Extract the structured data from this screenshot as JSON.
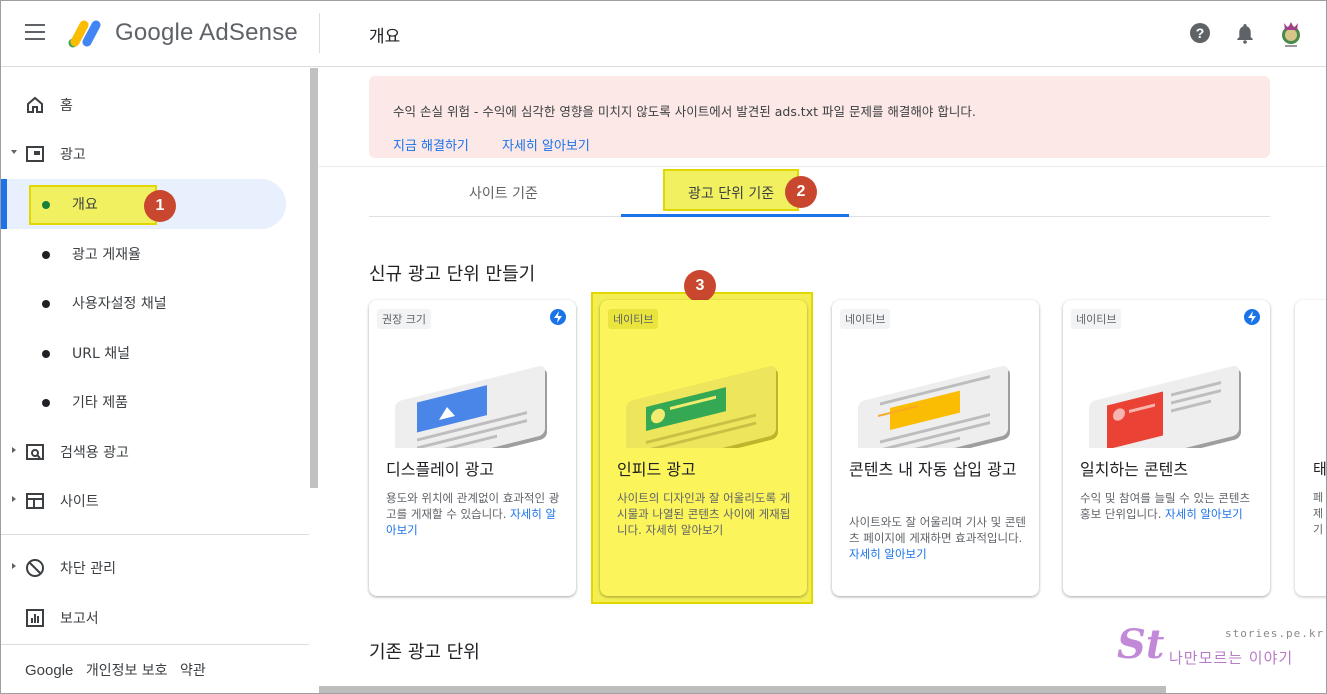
{
  "header": {
    "logo_text": "Google AdSense",
    "page_title": "개요"
  },
  "sidebar": {
    "items": [
      {
        "label": "홈"
      },
      {
        "label": "광고"
      },
      {
        "label": "개요"
      },
      {
        "label": "광고 게재율"
      },
      {
        "label": "사용자설정 채널"
      },
      {
        "label": "URL 채널"
      },
      {
        "label": "기타 제품"
      },
      {
        "label": "검색용 광고"
      },
      {
        "label": "사이트"
      },
      {
        "label": "차단 관리"
      },
      {
        "label": "보고서"
      }
    ],
    "footer": {
      "google": "Google",
      "privacy": "개인정보 보호",
      "terms": "약관"
    }
  },
  "alert": {
    "message": "수익 손실 위험 - 수익에 심각한 영향을 미치지 않도록 사이트에서 발견된 ads.txt 파일 문제를 해결해야 합니다.",
    "fix_link": "지금 해결하기",
    "learn_link": "자세히 알아보기",
    "background": "#fce8e6"
  },
  "tabs": [
    {
      "label": "사이트 기준"
    },
    {
      "label": "광고 단위 기준"
    }
  ],
  "sections": {
    "new_units": "신규 광고 단위 만들기",
    "existing_units": "기존 광고 단위"
  },
  "cards": [
    {
      "chip": "권장 크기",
      "title": "디스플레이 광고",
      "desc": "용도와 위치에 관계없이 효과적인 광고를 게재할 수 있습니다.",
      "link": "자세히 알아보기"
    },
    {
      "chip": "네이티브",
      "title": "인피드 광고",
      "desc": "사이트의 디자인과 잘 어울리도록 게시물과 나열된 콘텐츠 사이에 게재됩니다.",
      "link": "자세히 알아보기"
    },
    {
      "chip": "네이티브",
      "title": "콘텐츠 내 자동 삽입 광고",
      "desc": "사이트와도 잘 어울리며 기사 및 콘텐츠 페이지에 게재하면 효과적입니다.",
      "link": "자세히 알아보기"
    },
    {
      "chip": "네이티브",
      "title": "일치하는 콘텐츠",
      "desc": "수익 및 참여를 늘릴 수 있는 콘텐츠 홍보 단위입니다.",
      "link": "자세히 알아보기"
    }
  ],
  "partial_card": {
    "title": "태",
    "desc": "페\n제\n기"
  },
  "annotations": {
    "badge1": "1",
    "badge2": "2",
    "badge3": "3",
    "highlight_color": "#f0f060",
    "badge_color": "#c9472f"
  },
  "watermark": {
    "url": "stories.pe.kr",
    "name": "나만모르는 이야기",
    "logo": "St"
  },
  "colors": {
    "accent": "#1a73e8",
    "text": "#202124"
  }
}
